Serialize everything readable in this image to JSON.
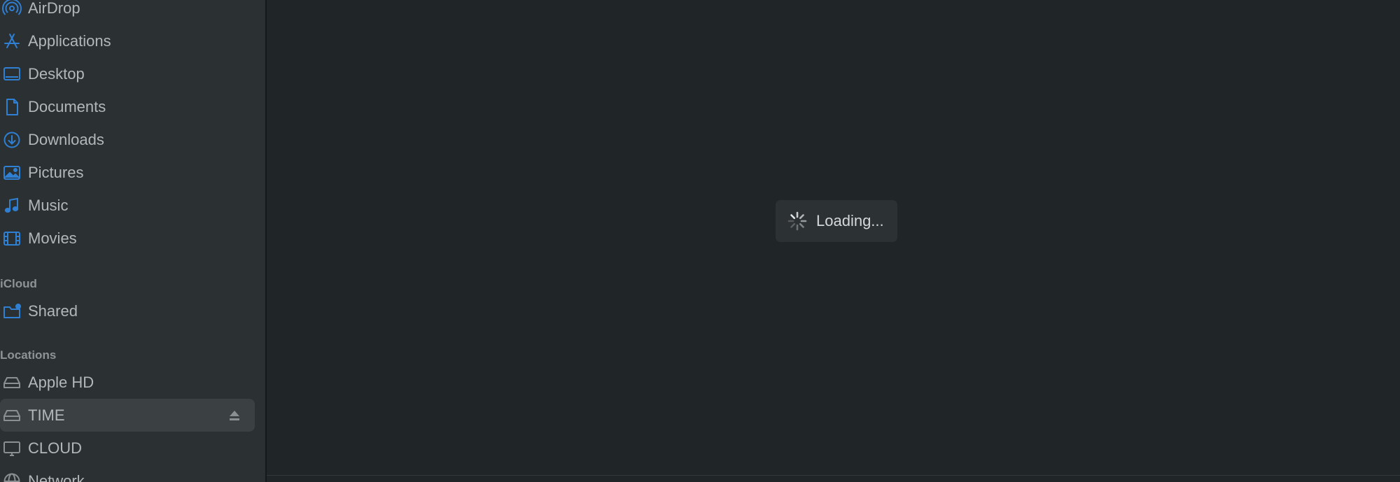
{
  "sidebar": {
    "favorites": [
      {
        "label": "AirDrop",
        "icon": "airdrop-icon"
      },
      {
        "label": "Applications",
        "icon": "applications-icon"
      },
      {
        "label": "Desktop",
        "icon": "desktop-icon"
      },
      {
        "label": "Documents",
        "icon": "document-icon"
      },
      {
        "label": "Downloads",
        "icon": "download-icon"
      },
      {
        "label": "Pictures",
        "icon": "pictures-icon"
      },
      {
        "label": "Music",
        "icon": "music-note-icon"
      },
      {
        "label": "Movies",
        "icon": "film-icon"
      }
    ],
    "icloud_header": "iCloud",
    "icloud": [
      {
        "label": "Shared",
        "icon": "shared-folder-icon"
      }
    ],
    "locations_header": "Locations",
    "locations": [
      {
        "label": "Apple HD",
        "icon": "drive-icon"
      },
      {
        "label": "TIME",
        "icon": "drive-icon",
        "selected": true,
        "eject": true
      },
      {
        "label": "CLOUD",
        "icon": "monitor-icon"
      },
      {
        "label": "Network",
        "icon": "globe-icon"
      }
    ]
  },
  "content": {
    "loading_text": "Loading..."
  },
  "colors": {
    "accent_icon": "#2f7fd3",
    "gray_icon": "#8a8f92",
    "sidebar_bg": "#2b3033",
    "content_bg": "#202527",
    "selected_row": "#3b4043"
  }
}
